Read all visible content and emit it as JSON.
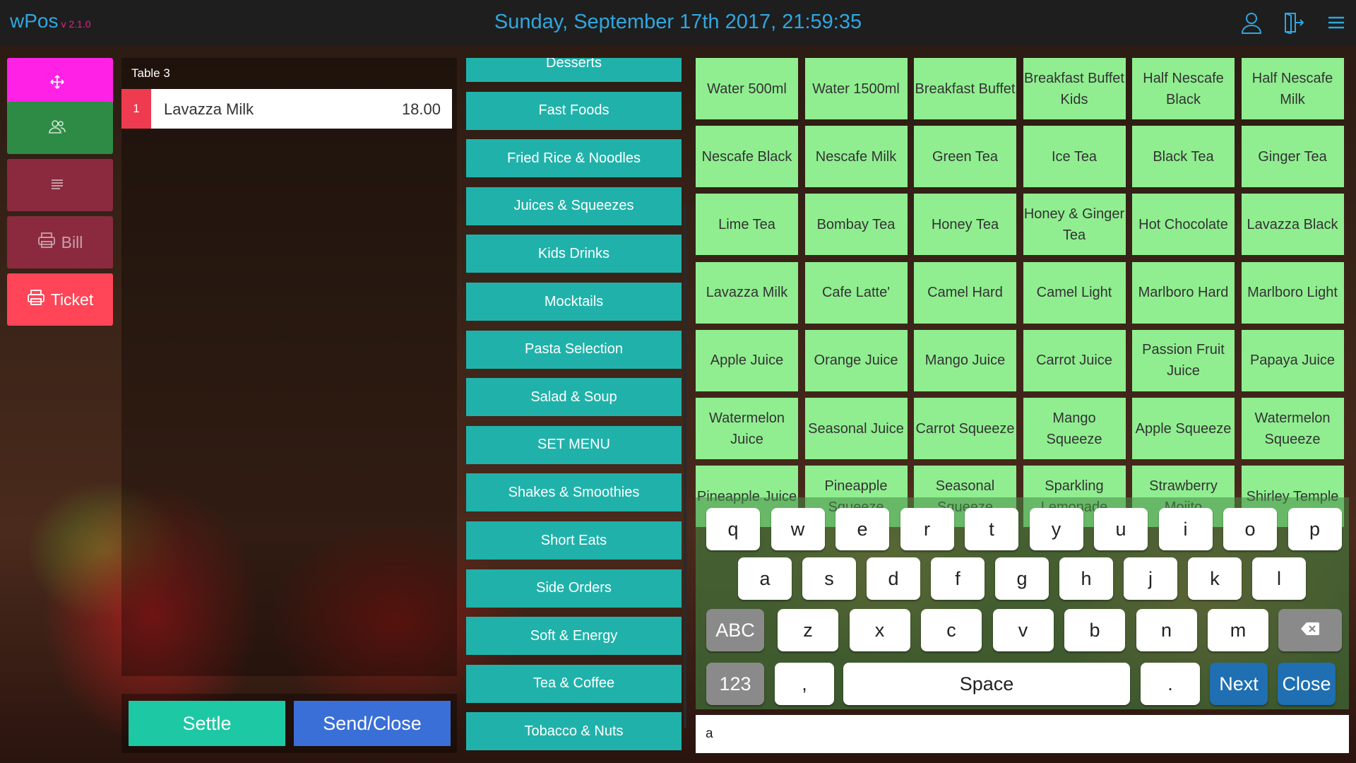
{
  "header": {
    "brand": "wPos",
    "version": "v 2.1.0",
    "datetime": "Sunday, September 17th 2017, 21:59:35",
    "icons": [
      "user-icon",
      "logout-icon",
      "menu-icon"
    ]
  },
  "actions": {
    "move_icon": "move-icon",
    "customers_icon": "customers-icon",
    "notes_icon": "notes-icon",
    "bill_label": "Bill",
    "ticket_label": "Ticket",
    "colors": {
      "move": "#ff22e6",
      "customers": "#2e8b46",
      "notes": "#8b2a3e",
      "bill": "#8b2a3e",
      "ticket": "#ff4557"
    }
  },
  "order": {
    "table": "Table 3",
    "lines": [
      {
        "qty": "1",
        "name": "Lavazza Milk",
        "price": "18.00"
      }
    ]
  },
  "footer": {
    "settle_label": "Settle",
    "send_label": "Send/Close"
  },
  "categories": [
    "Desserts",
    "Fast Foods",
    "Fried Rice & Noodles",
    "Juices & Squeezes",
    "Kids Drinks",
    "Mocktails",
    "Pasta Selection",
    "Salad & Soup",
    "SET MENU",
    "Shakes & Smoothies",
    "Short Eats",
    "Side Orders",
    "Soft & Energy",
    "Tea & Coffee",
    "Tobacco & Nuts"
  ],
  "items": [
    [
      "Water 500ml",
      "Water 1500ml",
      "Breakfast Buffet",
      "Breakfast Buffet Kids",
      "Half Nescafe Black",
      "Half Nescafe Milk"
    ],
    [
      "Nescafe Black",
      "Nescafe Milk",
      "Green Tea",
      "Ice Tea",
      "Black Tea",
      "Ginger Tea"
    ],
    [
      "Lime Tea",
      "Bombay Tea",
      "Honey Tea",
      "Honey & Ginger Tea",
      "Hot Chocolate",
      "Lavazza Black"
    ],
    [
      "Lavazza Milk",
      "Cafe Latte'",
      "Camel Hard",
      "Camel Light",
      "Marlboro Hard",
      "Marlboro Light"
    ],
    [
      "Apple Juice",
      "Orange Juice",
      "Mango Juice",
      "Carrot Juice",
      "Passion Fruit Juice",
      "Papaya Juice"
    ],
    [
      "Watermelon Juice",
      "Seasonal Juice",
      "Carrot Squeeze",
      "Mango Squeeze",
      "Apple Squeeze",
      "Watermelon Squeeze"
    ],
    [
      "Pineapple Juice",
      "Pineapple Squeeze",
      "Seasonal Squeeze",
      "Sparkling Lemonade",
      "Strawberry Mojito",
      "Shirley Temple"
    ]
  ],
  "keyboard": {
    "row1": [
      "q",
      "w",
      "e",
      "r",
      "t",
      "y",
      "u",
      "i",
      "o",
      "p"
    ],
    "row2": [
      "a",
      "s",
      "d",
      "f",
      "g",
      "h",
      "j",
      "k",
      "l"
    ],
    "row3": [
      "z",
      "x",
      "c",
      "v",
      "b",
      "n",
      "m"
    ],
    "abc_label": "ABC",
    "num_label": "123",
    "comma": ",",
    "space_label": "Space",
    "period": ".",
    "next_label": "Next",
    "close_label": "Close",
    "backspace_icon": "backspace-icon",
    "input_value": "a"
  }
}
